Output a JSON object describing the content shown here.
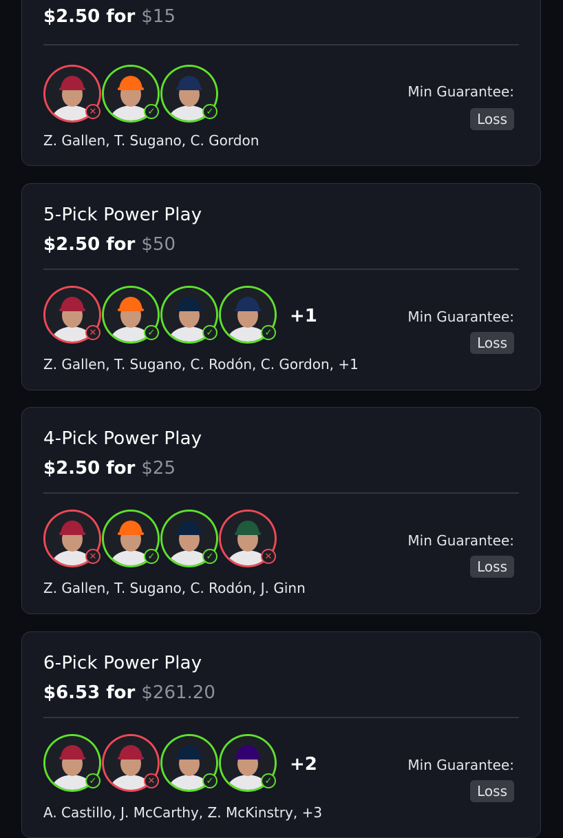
{
  "cards": [
    {
      "title": "",
      "stake": "$2.50",
      "for_word": "for",
      "payout": "$15",
      "players": [
        {
          "result": "loss",
          "team_color": "#a4203a"
        },
        {
          "result": "win",
          "team_color": "#ff6a13"
        },
        {
          "result": "win",
          "team_color": "#1a2f5c"
        }
      ],
      "extra": "",
      "names": "Z. Gallen, T. Sugano, C. Gordon",
      "guarantee_label": "Min Guarantee:",
      "guarantee_value": "Loss"
    },
    {
      "title": "5-Pick Power Play",
      "stake": "$2.50",
      "for_word": "for",
      "payout": "$50",
      "players": [
        {
          "result": "loss",
          "team_color": "#a4203a"
        },
        {
          "result": "win",
          "team_color": "#ff6a13"
        },
        {
          "result": "win",
          "team_color": "#0c2340"
        },
        {
          "result": "win",
          "team_color": "#1a2f5c"
        }
      ],
      "extra": "+1",
      "names": "Z. Gallen, T. Sugano, C. Rodón, C. Gordon, +1",
      "guarantee_label": "Min Guarantee:",
      "guarantee_value": "Loss"
    },
    {
      "title": "4-Pick Power Play",
      "stake": "$2.50",
      "for_word": "for",
      "payout": "$25",
      "players": [
        {
          "result": "loss",
          "team_color": "#a4203a"
        },
        {
          "result": "win",
          "team_color": "#ff6a13"
        },
        {
          "result": "win",
          "team_color": "#0c2340"
        },
        {
          "result": "loss",
          "team_color": "#1f5a3c"
        }
      ],
      "extra": "",
      "names": "Z. Gallen, T. Sugano, C. Rodón, J. Ginn",
      "guarantee_label": "Min Guarantee:",
      "guarantee_value": "Loss"
    },
    {
      "title": "6-Pick Power Play",
      "stake": "$6.53",
      "for_word": "for",
      "payout": "$261.20",
      "players": [
        {
          "result": "win",
          "team_color": "#a4203a"
        },
        {
          "result": "loss",
          "team_color": "#a4203a"
        },
        {
          "result": "win",
          "team_color": "#0c2340"
        },
        {
          "result": "win",
          "team_color": "#33006f"
        }
      ],
      "extra": "+2",
      "names": "A. Castillo, J. McCarthy, Z. McKinstry, +3",
      "guarantee_label": "Min Guarantee:",
      "guarantee_value": "Loss"
    }
  ],
  "icons": {
    "win": "checkmark-icon",
    "loss": "x-mark-icon"
  },
  "colors": {
    "win": "#5ee02c",
    "loss": "#ee4a55"
  }
}
